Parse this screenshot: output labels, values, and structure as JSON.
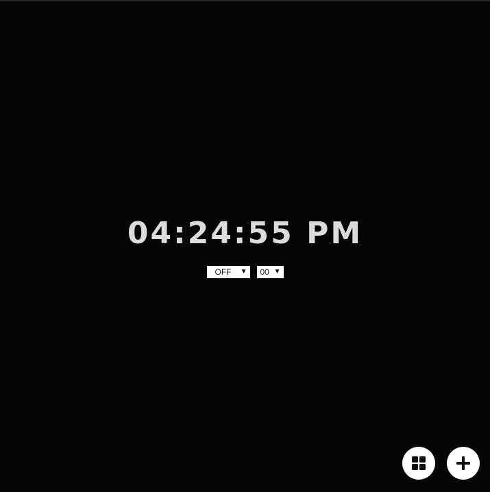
{
  "clock": {
    "time_text": "04:24:55 PM"
  },
  "alarm": {
    "mode_selected": "OFF",
    "minute_selected": "00"
  },
  "fab": {
    "grid_icon": "grid-icon",
    "add_icon": "plus-icon"
  },
  "colors": {
    "background": "#050505",
    "clock_text": "#dcdcdc",
    "button_bg": "#ffffff",
    "icon": "#111111"
  }
}
